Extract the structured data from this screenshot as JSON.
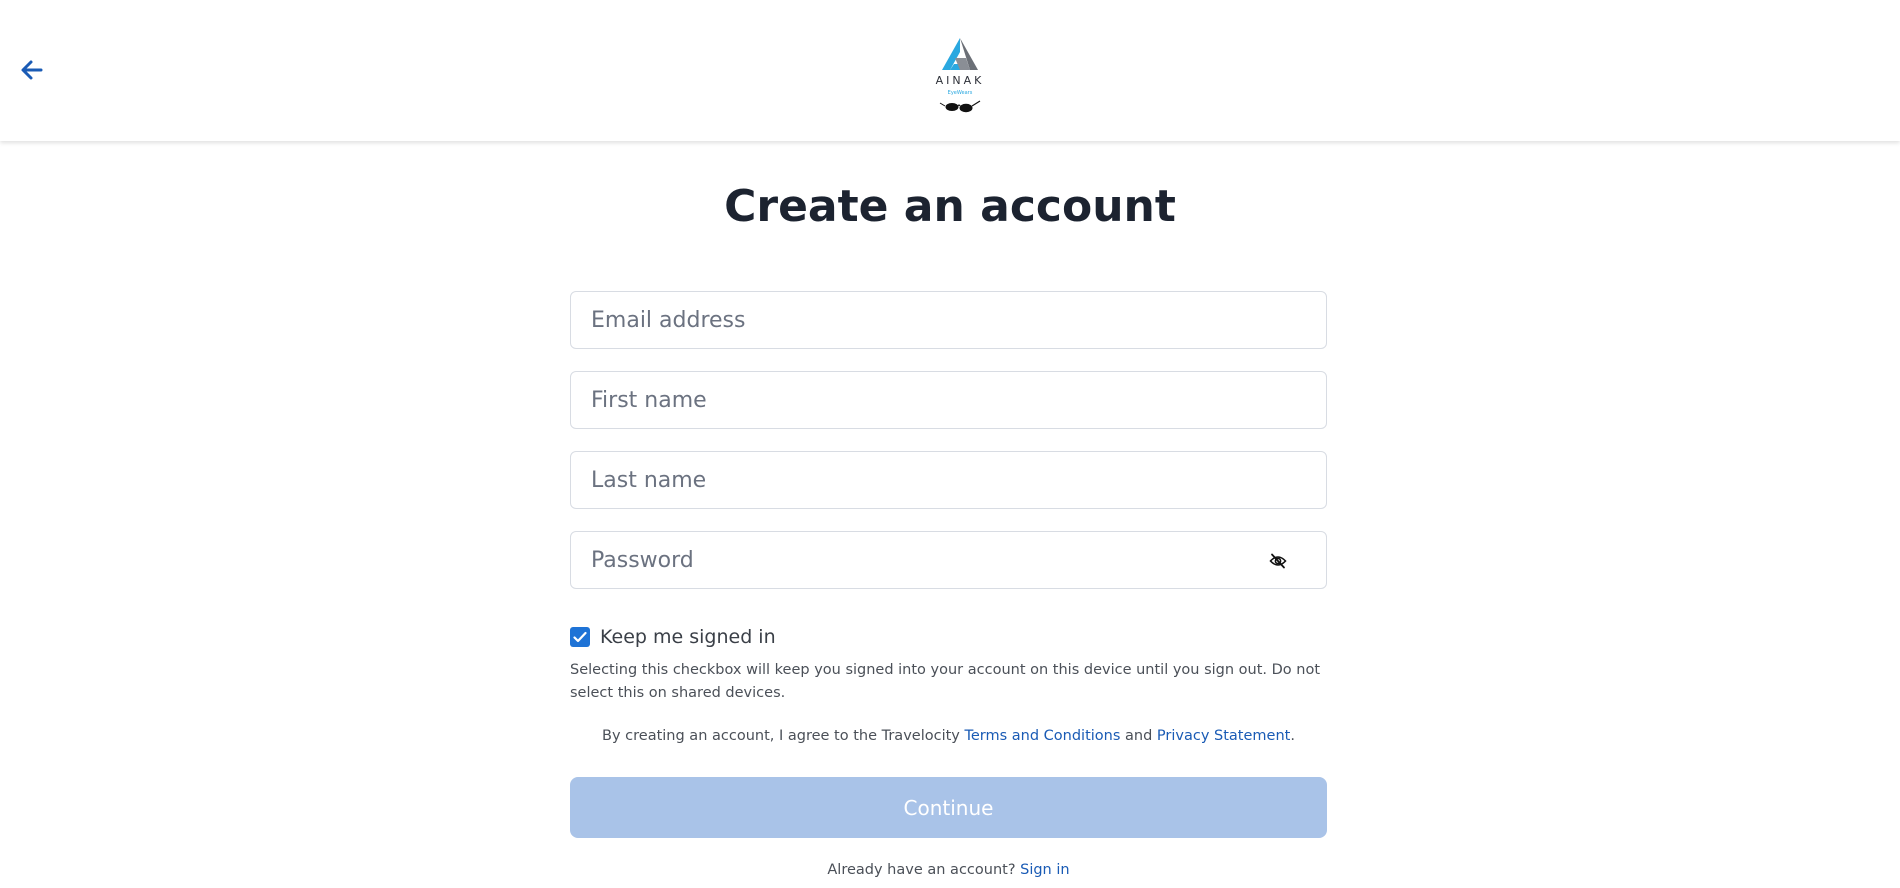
{
  "header": {
    "back_icon": "arrow-left-icon",
    "logo": {
      "name": "AINAK",
      "tagline": "EyeWears",
      "accent_color": "#2aa8e0"
    }
  },
  "main": {
    "title": "Create an account",
    "fields": {
      "email_placeholder": "Email address",
      "first_name_placeholder": "First name",
      "last_name_placeholder": "Last name",
      "password_placeholder": "Password",
      "password_toggle_icon": "eye-off-icon"
    },
    "keep_signed_in": {
      "checked": true,
      "label": "Keep me signed in",
      "help": "Selecting this checkbox will keep you signed into your account on this device until you sign out. Do not select this on shared devices."
    },
    "terms": {
      "prefix": "By creating an account, I agree to the Travelocity ",
      "terms_link": "Terms and Conditions",
      "and": " and ",
      "privacy_link": "Privacy Statement",
      "suffix": "."
    },
    "continue_label": "Continue",
    "signin": {
      "prompt": "Already have an account? ",
      "link": "Sign in"
    }
  },
  "colors": {
    "link": "#1a5bb5",
    "checkbox": "#1e73d6",
    "continue_disabled": "#a9c3e8"
  }
}
